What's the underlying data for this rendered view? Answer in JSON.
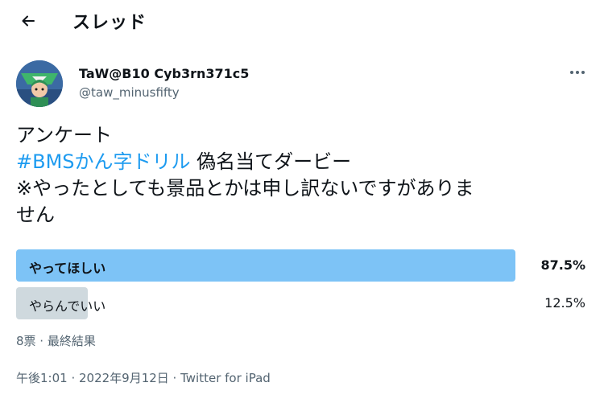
{
  "header": {
    "title": "スレッド",
    "back_icon": "arrow-left-icon"
  },
  "author": {
    "display_name": "TaW@B10 Cyb3rn371c5",
    "handle": "@taw_minusfifty",
    "more_icon": "more-horizontal-icon"
  },
  "tweet": {
    "line1": "アンケート",
    "hashtag": "#BMSかん字ドリル",
    "line2_rest": " 偽名当てダービー",
    "line3": "※やったとしても景品とかは申し訳ないですがありま",
    "line4": "せん"
  },
  "poll": {
    "options": [
      {
        "label": "やってほしい",
        "percent_text": "87.5%",
        "percent": 87.5,
        "winner": true
      },
      {
        "label": "やらんでいい",
        "percent_text": "12.5%",
        "percent": 12.5,
        "winner": false
      }
    ],
    "summary": "8票 · 最終結果"
  },
  "meta": {
    "timestamp_text": "午後1:01 · 2022年9月12日 · Twitter for iPad"
  },
  "colors": {
    "accent": "#1d9bf0",
    "winner_bar": "#7dc3f6",
    "loser_bar": "#cfd9de",
    "muted_text": "#536471"
  }
}
